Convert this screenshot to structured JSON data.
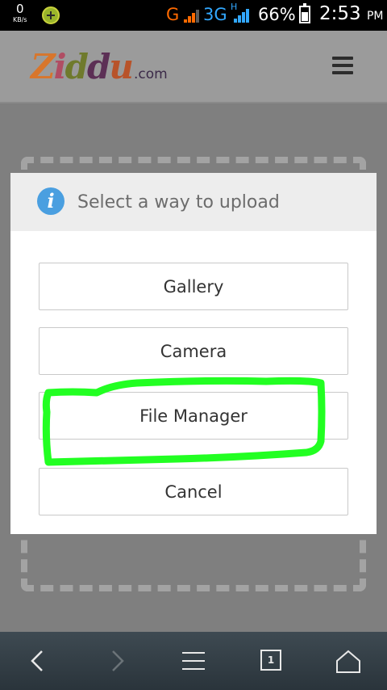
{
  "status_bar": {
    "net_speed_value": "0",
    "net_speed_unit": "KB/s",
    "carrier_g": "G",
    "network_type": "3G",
    "hspa_indicator": "H",
    "battery_percent": "66%",
    "time": "2:53",
    "ampm": "PM"
  },
  "app_bar": {
    "logo": {
      "z": "Z",
      "i": "i",
      "d1": "d",
      "d2": "d",
      "u": "u",
      "tld": ".com"
    }
  },
  "dialog": {
    "title": "Select a way to upload",
    "info_icon": "i",
    "options": {
      "gallery": "Gallery",
      "camera": "Camera",
      "file_manager": "File Manager",
      "cancel": "Cancel"
    }
  },
  "nav_bar": {
    "tab_count": "1"
  },
  "colors": {
    "highlight": "#22ff22",
    "info_blue": "#4a9fe0",
    "network_orange": "#ff6a00",
    "network_blue": "#32a8ff"
  }
}
